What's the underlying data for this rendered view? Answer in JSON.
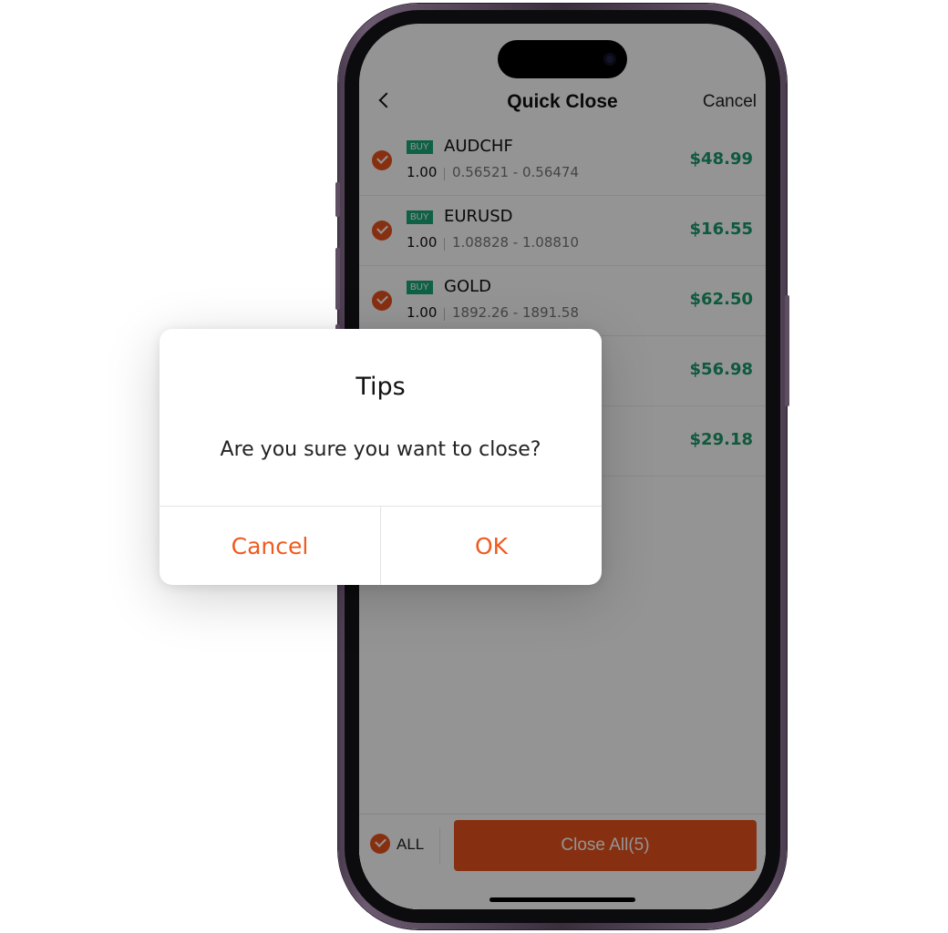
{
  "nav": {
    "title": "Quick Close",
    "cancel_label": "Cancel"
  },
  "positions": [
    {
      "side": "BUY",
      "symbol": "AUDCHF",
      "qty": "1.00",
      "prices": "0.56521 - 0.56474",
      "pnl": "$48.99"
    },
    {
      "side": "BUY",
      "symbol": "EURUSD",
      "qty": "1.00",
      "prices": "1.08828 - 1.08810",
      "pnl": "$16.55"
    },
    {
      "side": "BUY",
      "symbol": "GOLD",
      "qty": "1.00",
      "prices": "1892.26 - 1891.58",
      "pnl": "$62.50"
    },
    {
      "pnl": "$56.98"
    },
    {
      "pnl": "$29.18"
    }
  ],
  "bottom_bar": {
    "all_label": "ALL",
    "close_all_label": "Close All(5)"
  },
  "dialog": {
    "title": "Tips",
    "message": "Are you sure you want to close?",
    "cancel_label": "Cancel",
    "ok_label": "OK"
  },
  "colors": {
    "accent": "#e8541e",
    "profit": "#1a9a6c",
    "buy_badge": "#1aa878",
    "dialog_button": "#ef5a1f"
  }
}
